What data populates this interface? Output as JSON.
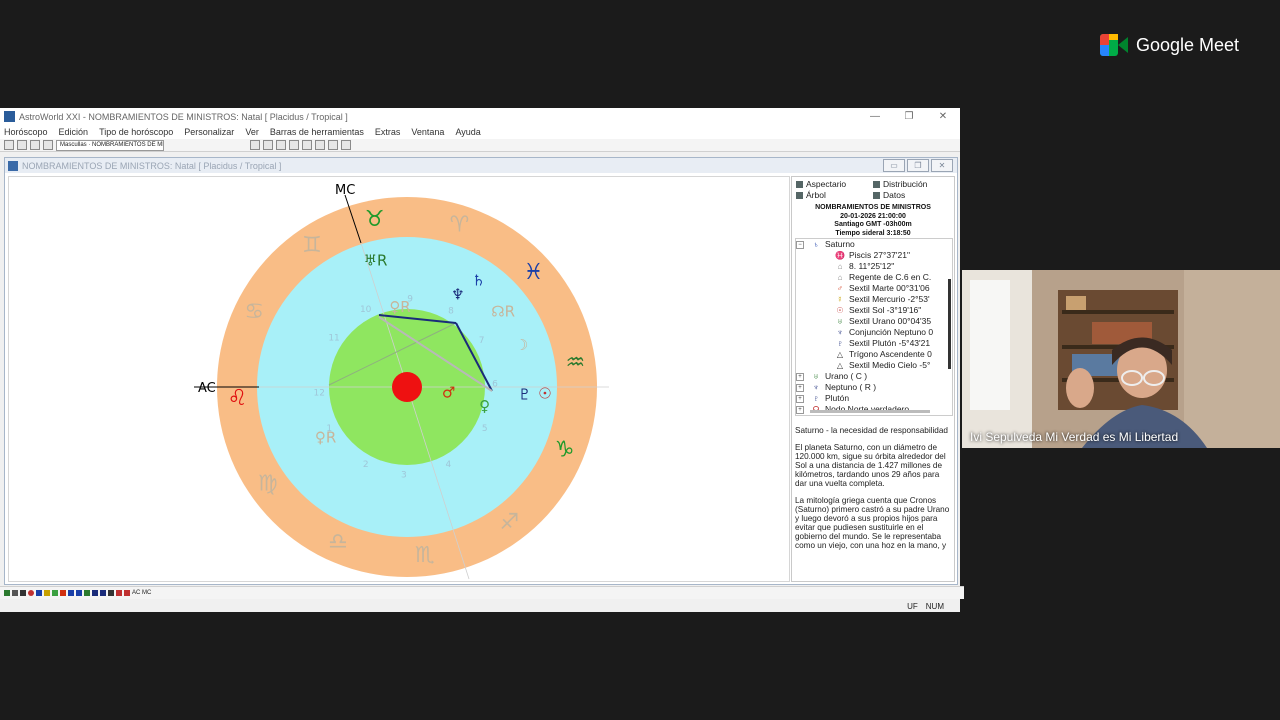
{
  "meet": {
    "brand": "Google Meet"
  },
  "window": {
    "title": "AstroWorld XXI - NOMBRAMIENTOS DE MINISTROS: Natal [ Placidus / Tropical ]",
    "controls": [
      "—",
      "❐",
      "✕"
    ]
  },
  "menu": [
    "Horóscopo",
    "Edición",
    "Tipo de horóscopo",
    "Personalizar",
    "Ver",
    "Barras de herramientas",
    "Extras",
    "Ventana",
    "Ayuda"
  ],
  "toolbar": {
    "input_value": "Mascullas · NOMBRAMIENTOS DE MINIST"
  },
  "child": {
    "title": "NOMBRAMIENTOS DE MINISTROS: Natal [ Placidus / Tropical ]",
    "controls": [
      "▭",
      "❐",
      "✕"
    ]
  },
  "chart": {
    "labels": {
      "ac": "AC",
      "mc": "MC"
    },
    "zodiac": [
      {
        "glyph": "♉",
        "color": "#1e9a2a"
      },
      {
        "glyph": "♈",
        "color": "#c7b59b"
      },
      {
        "glyph": "♓",
        "color": "#1a3fa8"
      },
      {
        "glyph": "♒",
        "color": "#2b7a2f"
      },
      {
        "glyph": "♑",
        "color": "#1e9a2a"
      },
      {
        "glyph": "♐",
        "color": "#c7b59b"
      },
      {
        "glyph": "♏",
        "color": "#c7b59b"
      },
      {
        "glyph": "♎",
        "color": "#c7b59b"
      },
      {
        "glyph": "♍",
        "color": "#c7b59b"
      },
      {
        "glyph": "♌",
        "color": "#e01010"
      },
      {
        "glyph": "♋",
        "color": "#c7b59b"
      },
      {
        "glyph": "♊",
        "color": "#c7b59b"
      }
    ],
    "houses": [
      "1",
      "2",
      "3",
      "4",
      "5",
      "6",
      "7",
      "8",
      "9",
      "10",
      "11",
      "12"
    ],
    "planets": [
      {
        "glyph": "♅R",
        "color": "#2b7a2f"
      },
      {
        "glyph": "♆",
        "color": "#1a2b7a"
      },
      {
        "glyph": "♄",
        "color": "#1a3fa8"
      },
      {
        "glyph": "☊R",
        "color": "#c7b59b"
      },
      {
        "glyph": "☽",
        "color": "#c7b59b"
      },
      {
        "glyph": "♀R",
        "color": "#c7b59b"
      },
      {
        "glyph": "♇",
        "color": "#1a2b7a"
      },
      {
        "glyph": "☉",
        "color": "#c03030"
      },
      {
        "glyph": "♂",
        "color": "#d03010"
      },
      {
        "glyph": "♀",
        "color": "#3aa040"
      },
      {
        "glyph": "♀R",
        "color": "#c7b59b"
      }
    ]
  },
  "panel": {
    "tabs": [
      "Aspectario",
      "Distribución",
      "Árbol",
      "Datos"
    ],
    "info": [
      "NOMBRAMIENTOS DE MINISTROS",
      "20-01-2026 21:00:00",
      "Santiago GMT -03h00m",
      "Tiempo sideral 3:18:50"
    ],
    "tree": {
      "planet": "Saturno",
      "details": [
        "Piscis 27°37'21\"",
        "8. 11°25'12\"",
        "Regente de C.6 en C.",
        "Sextil Marte 00°31'06",
        "Sextil Mercurio -2°53'",
        "Sextil Sol -3°19'16\"",
        "Sextil Urano 00°04'35",
        "Conjunción Neptuno 0",
        "Sextil Plutón -5°43'21",
        "Trígono Ascendente 0",
        "Sextil Medio Cielo -5°"
      ],
      "others": [
        "Urano ( C )",
        "Neptuno ( R )",
        "Plutón",
        "Nodo Norte verdadero"
      ]
    },
    "description": [
      "Saturno - la necesidad de responsabilidad",
      "El planeta Saturno, con un diámetro de 120.000 km, sigue su órbita alrededor del Sol a una distancia de 1.427 millones de kilómetros, tardando unos 29 años para dar una vuelta completa.",
      "La mitología griega cuenta que Cronos (Saturno) primero castró a su padre Urano y luego devoró a sus propios hijos para evitar que pudiesen sustituirle en el gobierno del mundo. Se le representaba como un viejo, con una hoz en la mano, y"
    ]
  },
  "bottombar": {
    "label": "AC MC"
  },
  "status": {
    "uf": "UF",
    "num": "NUM"
  },
  "video": {
    "participant_name": "Ivi Sepulveda Mi Verdad es Mi Libertad"
  }
}
